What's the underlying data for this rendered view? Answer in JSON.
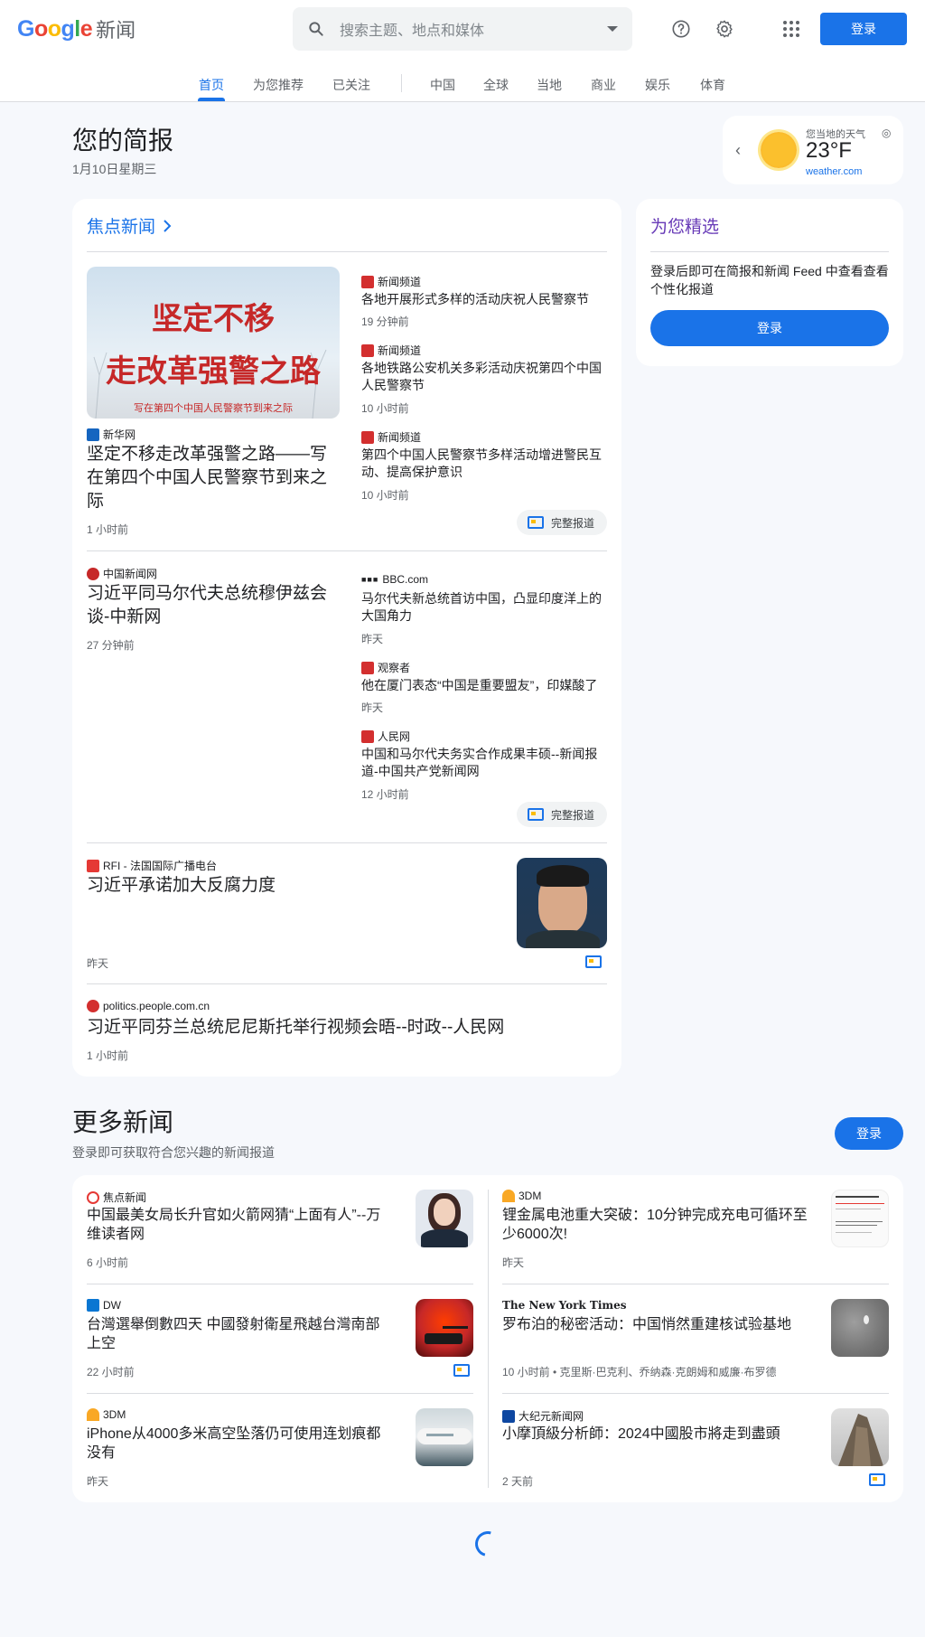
{
  "header": {
    "logo_google": "Google",
    "logo_news": "新闻",
    "search_placeholder": "搜索主题、地点和媒体",
    "login": "登录"
  },
  "nav": [
    "首页",
    "为您推荐",
    "已关注",
    "中国",
    "全球",
    "当地",
    "商业",
    "娱乐",
    "体育"
  ],
  "briefing": {
    "title": "您的简报",
    "date": "1月10日星期三"
  },
  "weather": {
    "label": "您当地的天气",
    "temp": "23°F",
    "source": "weather.com"
  },
  "top_stories": {
    "title": "焦点新闻",
    "full_coverage": "完整报道",
    "cluster1": {
      "main": {
        "image_text_1": "坚定不移",
        "image_text_2": "走改革强警之路",
        "image_caption": "写在第四个中国人民警察节到来之际",
        "source": "新华网",
        "title": "坚定不移走改革强警之路——写在第四个中国人民警察节到来之际",
        "time": "1 小时前"
      },
      "side": [
        {
          "source": "新闻频道",
          "title": "各地开展形式多样的活动庆祝人民警察节",
          "time": "19 分钟前"
        },
        {
          "source": "新闻频道",
          "title": "各地铁路公安机关多彩活动庆祝第四个中国人民警察节",
          "time": "10 小时前"
        },
        {
          "source": "新闻频道",
          "title": "第四个中国人民警察节多样活动增进警民互动、提高保护意识",
          "time": "10 小时前"
        }
      ]
    },
    "cluster2": {
      "main": {
        "source": "中国新闻网",
        "title": "习近平同马尔代夫总统穆伊兹会谈-中新网",
        "time": "27 分钟前"
      },
      "side": [
        {
          "source": "BBC.com",
          "title": "马尔代夫新总统首访中国，凸显印度洋上的大国角力",
          "time": "昨天"
        },
        {
          "source": "观察者",
          "title": "他在厦门表态“中国是重要盟友”，印媒酸了",
          "time": "昨天"
        },
        {
          "source": "人民网",
          "title": "中国和马尔代夫务实合作成果丰硕--新闻报道-中国共产党新闻网",
          "time": "12 小时前"
        }
      ]
    },
    "story3": {
      "source": "RFI - 法国国际广播电台",
      "title": "习近平承诺加大反腐力度",
      "time": "昨天"
    },
    "story4": {
      "source": "politics.people.com.cn",
      "title": "习近平同芬兰总统尼尼斯托举行视频会晤--时政--人民网",
      "time": "1 小时前"
    }
  },
  "for_you": {
    "title": "为您精选",
    "text": "登录后即可在简报和新闻 Feed 中查看查看个性化报道",
    "button": "登录"
  },
  "more_news": {
    "title": "更多新闻",
    "subtitle": "登录即可获取符合您兴趣的新闻报道",
    "button": "登录",
    "left": [
      {
        "source": "焦点新闻",
        "title": "中国最美女局长升官如火箭网猜“上面有人”--万维读者网",
        "time": "6 小时前"
      },
      {
        "source": "DW",
        "title": "台灣選舉倒數四天 中國發射衛星飛越台灣南部上空",
        "time": "22 小时前"
      },
      {
        "source": "3DM",
        "title": "iPhone从4000多米高空坠落仍可使用连划痕都没有",
        "time": "昨天"
      }
    ],
    "right": [
      {
        "source": "3DM",
        "title": "锂金属电池重大突破：10分钟完成充电可循环至少6000次!",
        "time": "昨天"
      },
      {
        "source": "The New York Times",
        "title": "罗布泊的秘密活动：中国悄然重建核试验基地",
        "time": "10 小时前 • 克里斯·巴克利、乔纳森·克朗姆和威廉·布罗德"
      },
      {
        "source": "大纪元新闻网",
        "title": "小摩頂級分析師：2024中國股市將走到盡頭",
        "time": "2 天前"
      }
    ]
  },
  "colors": {
    "accent": "#1a73e8",
    "background": "#f6f8fc",
    "card": "#ffffff"
  }
}
